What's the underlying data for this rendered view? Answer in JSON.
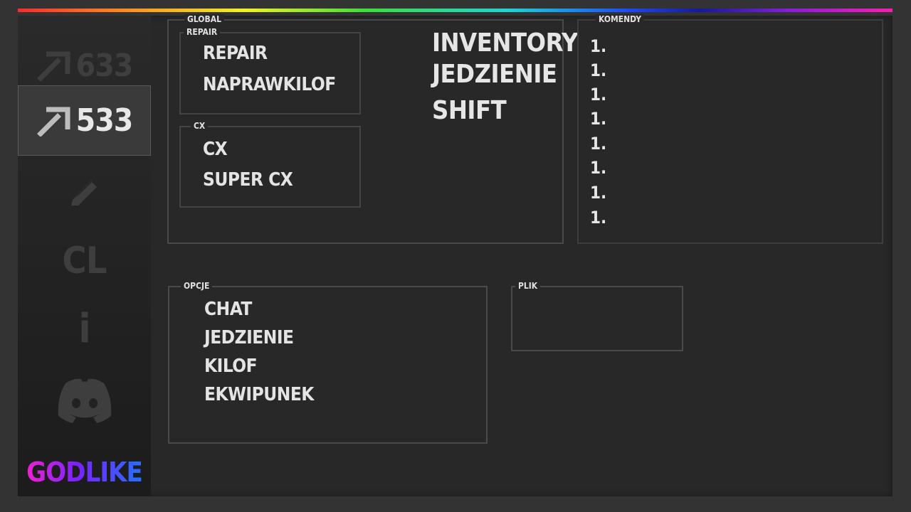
{
  "sidebar": {
    "items": [
      {
        "icon": "pickaxe-icon",
        "label": "633"
      },
      {
        "icon": "pickaxe-icon",
        "label": "533"
      },
      {
        "icon": "pencil-icon"
      },
      {
        "label": "CL"
      },
      {
        "label": "i"
      },
      {
        "icon": "discord-icon"
      }
    ],
    "brand": "GODLIKE"
  },
  "global": {
    "legend": "GLOBAL",
    "repair": {
      "legend": "REPAIR",
      "items": [
        "REPAIR",
        "NAPRAWKILOF"
      ]
    },
    "cx": {
      "legend": "CX",
      "items": [
        "CX",
        "SUPER CX"
      ]
    },
    "toggles": [
      "INVENTORY",
      "JEDZIENIE",
      "SHIFT"
    ]
  },
  "komendy": {
    "legend": "KOMENDY",
    "items": [
      "1.",
      "1.",
      "1.",
      "1.",
      "1.",
      "1.",
      "1.",
      "1."
    ]
  },
  "opcje": {
    "legend": "OPCJE",
    "items": [
      "CHAT",
      "JEDZIENIE",
      "KILOF",
      "EKWIPUNEK"
    ]
  },
  "plik": {
    "legend": "PLIK"
  },
  "colors": {
    "background": "#282828",
    "accent_gradient": [
      "#ff22c8",
      "#7a22ff",
      "#1a7aff"
    ]
  }
}
